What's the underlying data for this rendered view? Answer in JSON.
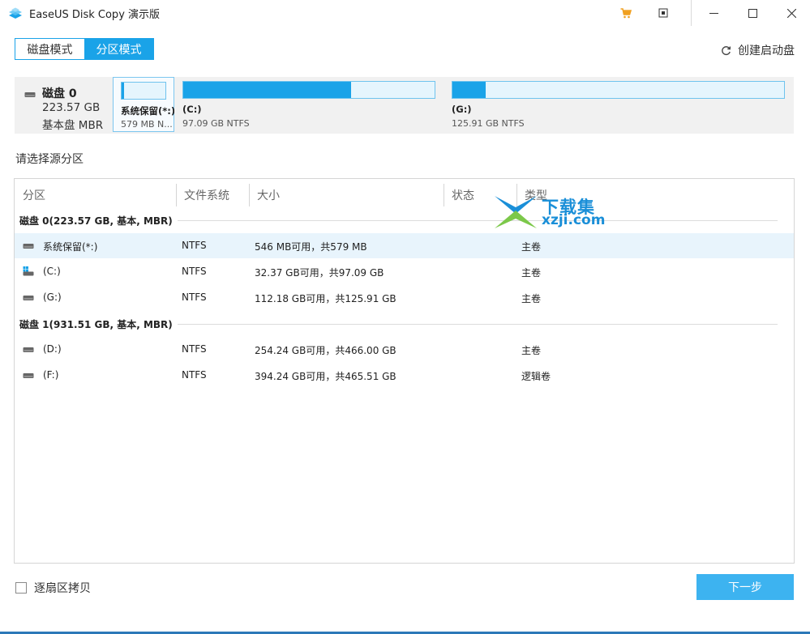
{
  "window": {
    "title": "EaseUS Disk Copy 演示版"
  },
  "mode_tabs": [
    {
      "label": "磁盘模式",
      "active": false
    },
    {
      "label": "分区模式",
      "active": true
    }
  ],
  "create_bootable_label": "创建启动盘",
  "disk_map": {
    "disk_name": "磁盘 0",
    "disk_size": "223.57 GB",
    "disk_type": "基本盘 MBR",
    "partitions": [
      {
        "label": "系统保留(*:)",
        "sub": "579 MB N...",
        "used_fraction": 0.057,
        "selected": true
      },
      {
        "label": "(C:)",
        "sub": "97.09 GB NTFS",
        "used_fraction": 0.667,
        "selected": false
      },
      {
        "label": "(G:)",
        "sub": "125.91 GB NTFS",
        "used_fraction": 0.1,
        "selected": false
      }
    ]
  },
  "select_source_label": "请选择源分区",
  "table": {
    "headers": [
      "分区",
      "文件系统",
      "大小",
      "状态",
      "类型"
    ],
    "groups": [
      {
        "label": "磁盘 0(223.57 GB, 基本, MBR)",
        "rows": [
          {
            "name": "系统保留(*:)",
            "fs": "NTFS",
            "size": "546 MB可用，共579 MB",
            "status": "",
            "type": "主卷",
            "highlight": true,
            "icon": "drive-icon"
          },
          {
            "name": "(C:)",
            "fs": "NTFS",
            "size": "32.37 GB可用，共97.09 GB",
            "status": "",
            "type": "主卷",
            "highlight": false,
            "icon": "windows-drive-icon"
          },
          {
            "name": "(G:)",
            "fs": "NTFS",
            "size": "112.18 GB可用，共125.91 GB",
            "status": "",
            "type": "主卷",
            "highlight": false,
            "icon": "drive-icon"
          }
        ]
      },
      {
        "label": "磁盘 1(931.51 GB, 基本, MBR)",
        "rows": [
          {
            "name": "(D:)",
            "fs": "NTFS",
            "size": "254.24 GB可用，共466.00 GB",
            "status": "",
            "type": "主卷",
            "highlight": false,
            "icon": "drive-icon"
          },
          {
            "name": "(F:)",
            "fs": "NTFS",
            "size": "394.24 GB可用，共465.51 GB",
            "status": "",
            "type": "逻辑卷",
            "highlight": false,
            "icon": "drive-icon"
          }
        ]
      }
    ]
  },
  "watermark": {
    "title": "下载集",
    "sub": "xzji.com"
  },
  "sector_copy_label": "逐扇区拷贝",
  "next_button_label": "下一步",
  "colors": {
    "accent": "#1aa3e8",
    "button": "#3db3f0",
    "cart": "#f0a020"
  }
}
